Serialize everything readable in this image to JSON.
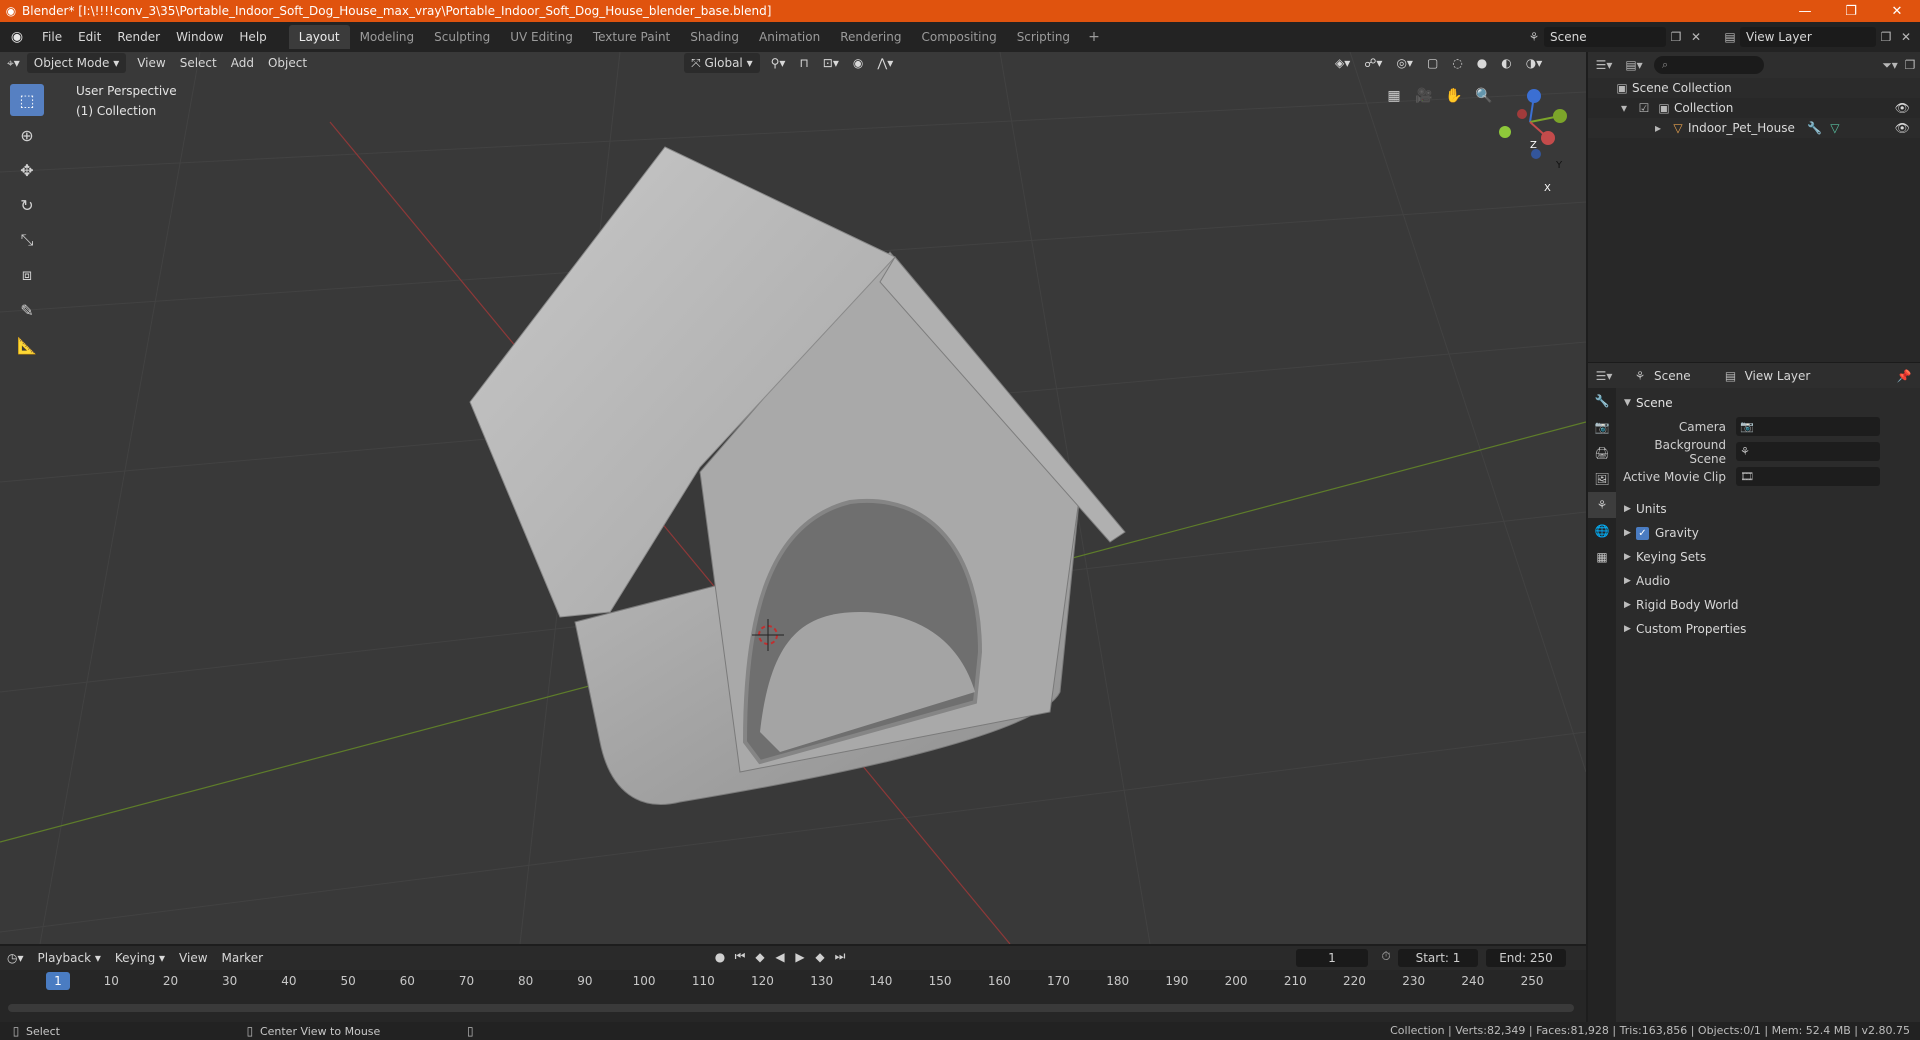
{
  "window": {
    "title": "Blender* [I:\\!!!!conv_3\\35\\Portable_Indoor_Soft_Dog_House_max_vray\\Portable_Indoor_Soft_Dog_House_blender_base.blend]",
    "minimize": "—",
    "maximize": "❐",
    "close": "✕"
  },
  "menu": {
    "items": [
      "File",
      "Edit",
      "Render",
      "Window",
      "Help"
    ]
  },
  "workspaces": {
    "tabs": [
      "Layout",
      "Modeling",
      "Sculpting",
      "UV Editing",
      "Texture Paint",
      "Shading",
      "Animation",
      "Rendering",
      "Compositing",
      "Scripting"
    ],
    "active": "Layout",
    "add": "+"
  },
  "scene_selector": {
    "value": "Scene"
  },
  "view_layer_selector": {
    "value": "View Layer"
  },
  "viewport": {
    "mode": "Object Mode",
    "menus": [
      "View",
      "Select",
      "Add",
      "Object"
    ],
    "transform_orientation": "Global",
    "info_line1": "User Perspective",
    "info_line2": "(1) Collection",
    "gizmo": {
      "z": "Z",
      "y": "Y",
      "x": "X"
    }
  },
  "outliner": {
    "search_placeholder": "",
    "rows": [
      {
        "label": "Scene Collection"
      },
      {
        "label": "Collection"
      },
      {
        "label": "Indoor_Pet_House"
      }
    ]
  },
  "properties": {
    "header_scene": "Scene",
    "header_view_layer": "View Layer",
    "panel_title": "Scene",
    "fields": [
      {
        "label": "Camera",
        "value": ""
      },
      {
        "label": "Background Scene",
        "value": ""
      },
      {
        "label": "Active Movie Clip",
        "value": ""
      }
    ],
    "subpanels": [
      "Units",
      "Gravity",
      "Keying Sets",
      "Audio",
      "Rigid Body World",
      "Custom Properties"
    ],
    "gravity_checked": true
  },
  "timeline": {
    "menus": [
      "Playback",
      "Keying",
      "View",
      "Marker"
    ],
    "current_frame": "1",
    "start_label": "Start:",
    "start_value": "1",
    "end_label": "End:",
    "end_value": "250",
    "ruler_labels": [
      "1",
      "10",
      "20",
      "30",
      "40",
      "50",
      "60",
      "70",
      "80",
      "90",
      "100",
      "110",
      "120",
      "130",
      "140",
      "150",
      "160",
      "170",
      "180",
      "190",
      "200",
      "210",
      "220",
      "230",
      "240",
      "250"
    ]
  },
  "status": {
    "left1": "Select",
    "left2": "Center View to Mouse",
    "right": "Collection | Verts:82,349 | Faces:81,928 | Tris:163,856 | Objects:0/1 | Mem: 52.4 MB | v2.80.75"
  }
}
